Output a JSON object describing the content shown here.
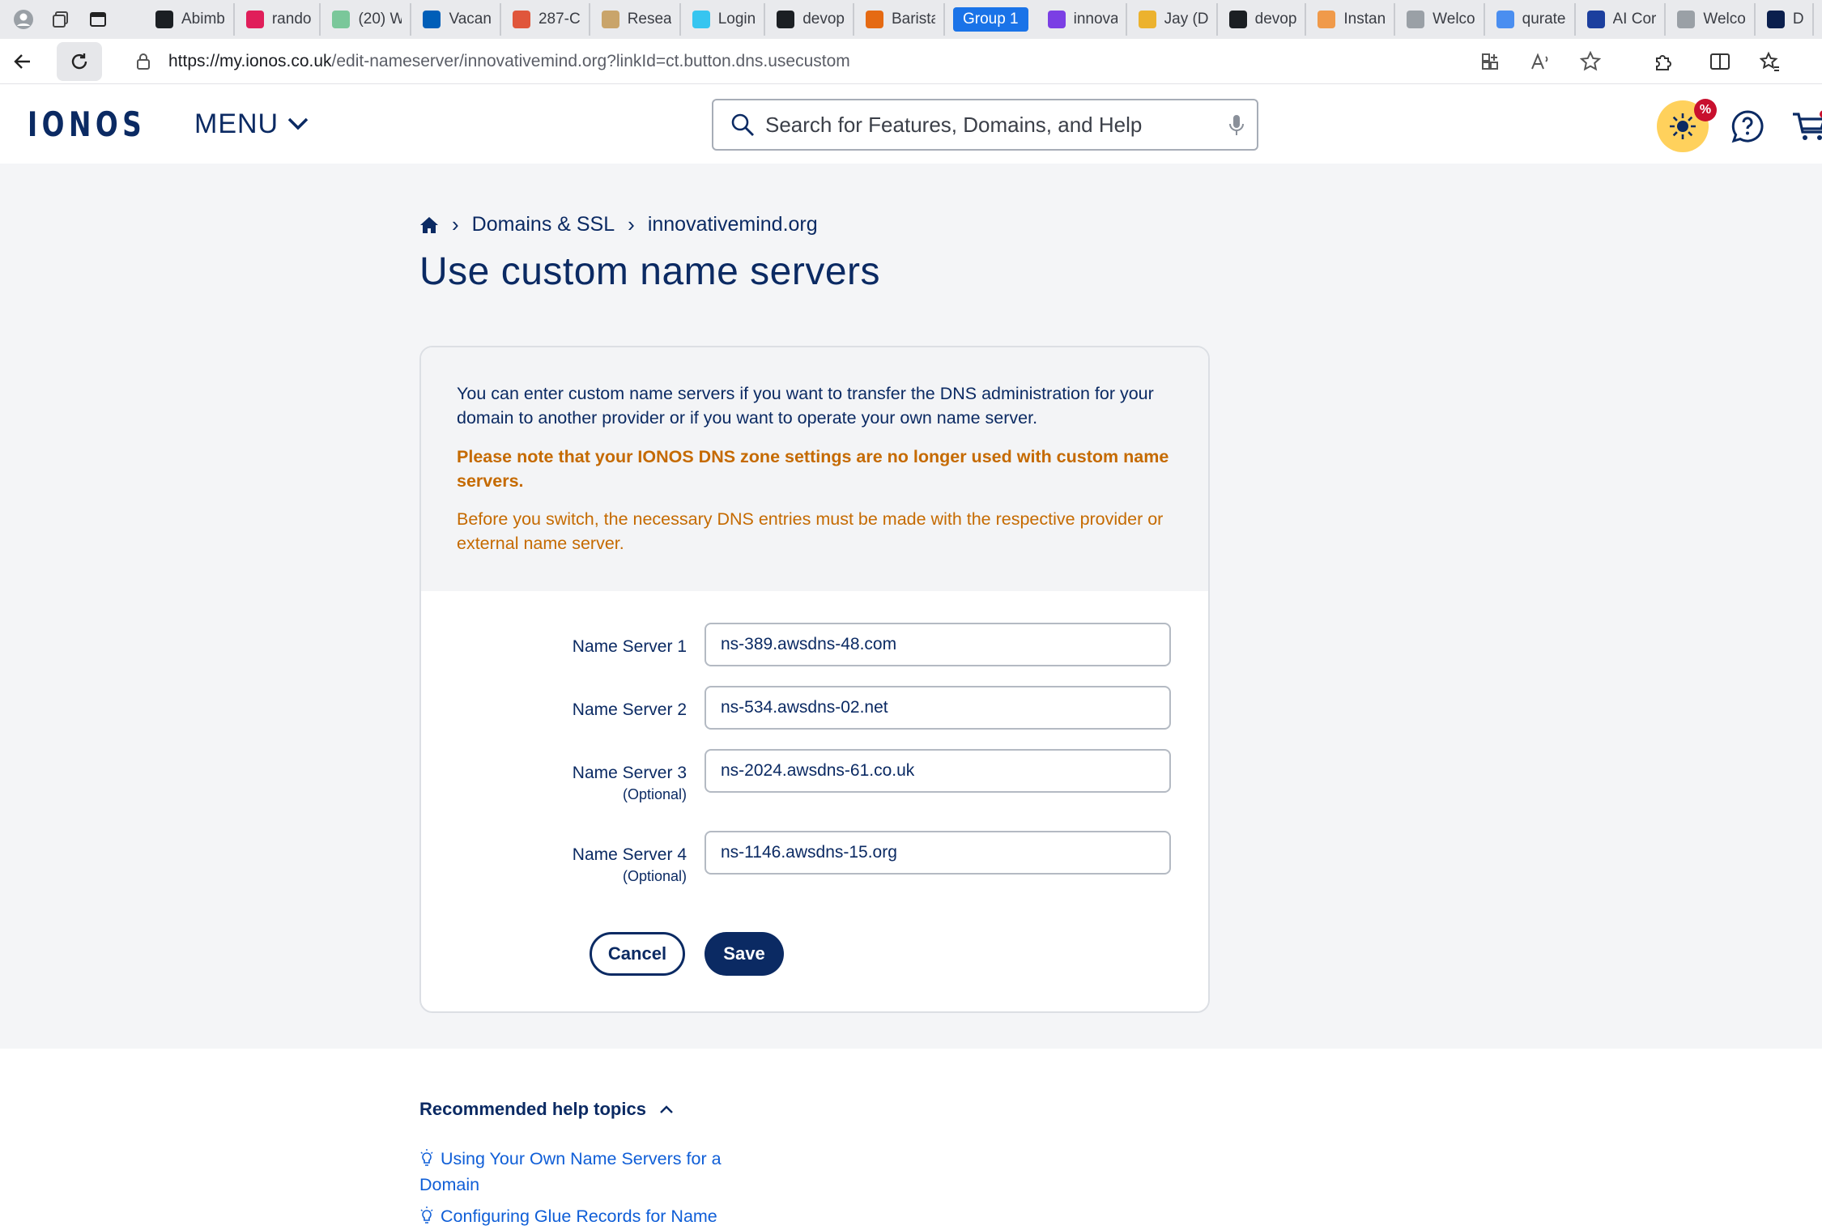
{
  "browser": {
    "tabs": [
      {
        "title": "Abimb",
        "icon": "github-icon",
        "color": "#1b1f23"
      },
      {
        "title": "rando",
        "icon": "slack-icon",
        "color": "#e01e5a"
      },
      {
        "title": "(20) W",
        "icon": "whatsapp-icon",
        "color": "#7ac79a"
      },
      {
        "title": "Vacan",
        "icon": "nhs-icon",
        "color": "#005eb8"
      },
      {
        "title": "287-C",
        "icon": "pdf-icon",
        "color": "#e0563b"
      },
      {
        "title": "Resear",
        "icon": "bracket-icon",
        "color": "#c9a46a"
      },
      {
        "title": "Login",
        "icon": "slack-icon",
        "color": "#36c5f0"
      },
      {
        "title": "devop",
        "icon": "github-icon",
        "color": "#1b1f23"
      },
      {
        "title": "Barista",
        "icon": "t-logo-icon",
        "color": "#e56a13"
      }
    ],
    "group_label": "Group 1",
    "tabs_after_group": [
      {
        "title": "innova",
        "icon": "purple-app-icon",
        "color": "#7b3fe4"
      },
      {
        "title": "Jay (D",
        "icon": "slack-icon",
        "color": "#ecb22e"
      },
      {
        "title": "devop",
        "icon": "github-icon",
        "color": "#1b1f23"
      },
      {
        "title": "Instan",
        "icon": "orange-app-icon",
        "color": "#f09a4a"
      },
      {
        "title": "Welco",
        "icon": "page-icon",
        "color": "#9aa0a6"
      },
      {
        "title": "qurate",
        "icon": "search-icon",
        "color": "#4a8ef0"
      },
      {
        "title": "AI Cor",
        "icon": "q-logo-icon",
        "color": "#1c3f9e"
      },
      {
        "title": "Welco",
        "icon": "page-icon",
        "color": "#9aa0a6"
      },
      {
        "title": "D",
        "icon": "v-logo-icon",
        "color": "#0b1f4d"
      }
    ],
    "url_host": "https://my.ionos.co.uk",
    "url_path": "/edit-nameserver/innovativemind.org?linkId=ct.button.dns.usecustom"
  },
  "header": {
    "logo": "IONOS",
    "menu_label": "MENU",
    "search_placeholder": "Search for Features, Domains, and Help",
    "promo_badge": "%"
  },
  "breadcrumb": {
    "items": [
      "Domains & SSL",
      "innovativemind.org"
    ]
  },
  "page_title": "Use custom name servers",
  "info": {
    "text": "You can enter custom name servers if you want to transfer the DNS administration for your domain to another provider or if you want to operate your own name server.",
    "warning_bold": "Please note that your IONOS DNS zone settings are no longer used with custom name servers.",
    "warning_text": "Before you switch, the necessary DNS entries must be made with the respective provider or external name server."
  },
  "form": {
    "fields": [
      {
        "label": "Name Server 1",
        "optional": "",
        "value": "ns-389.awsdns-48.com"
      },
      {
        "label": "Name Server 2",
        "optional": "",
        "value": "ns-534.awsdns-02.net"
      },
      {
        "label": "Name Server 3",
        "optional": "(Optional)",
        "value": "ns-2024.awsdns-61.co.uk"
      },
      {
        "label": "Name Server 4",
        "optional": "(Optional)",
        "value": "ns-1146.awsdns-15.org"
      }
    ],
    "cancel_label": "Cancel",
    "save_label": "Save"
  },
  "help": {
    "title": "Recommended help topics",
    "links": [
      "Using Your Own Name Servers for a Domain",
      "Configuring Glue Records for Name"
    ]
  },
  "colors": {
    "brand": "#0b2a63",
    "warning": "#c56a00",
    "link": "#0f5ed7",
    "promo": "#ffd15c"
  }
}
